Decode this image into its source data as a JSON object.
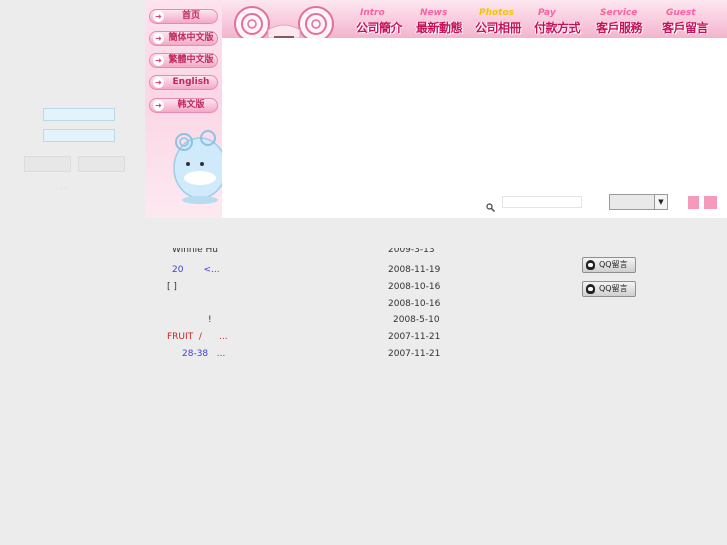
{
  "languages": [
    {
      "label": "首页"
    },
    {
      "label": "簡体中文版"
    },
    {
      "label": "繁體中文版"
    },
    {
      "label": "English"
    },
    {
      "label": "韩文版"
    }
  ],
  "nav": [
    {
      "en": "Intro",
      "zh": "公司簡介"
    },
    {
      "en": "News",
      "zh": "最新動態"
    },
    {
      "en": "Photos",
      "zh": "公司相冊"
    },
    {
      "en": "Pay",
      "zh": "付款方式"
    },
    {
      "en": "Service",
      "zh": "客戶服務"
    },
    {
      "en": "Guest",
      "zh": "客戶留言"
    }
  ],
  "left_dots": ". . .",
  "news": [
    {
      "title": "Winnie Hu",
      "date": "2009-3-13",
      "color": "#333333"
    },
    {
      "title": "20       <...",
      "date": "2008-11-19",
      "color": "#4040dd"
    },
    {
      "title": "[ ]",
      "date": "2008-10-16",
      "color": "#333333"
    },
    {
      "title": "",
      "date": "2008-10-16",
      "color": "#333333"
    },
    {
      "title": "!",
      "date": "2008-5-10",
      "color": "#333333"
    },
    {
      "title": "FRUIT  /      ...",
      "date": "2007-11-21",
      "color": "#cc2222"
    },
    {
      "title": "28-38   ...",
      "date": "2007-11-21",
      "color": "#4040dd"
    }
  ],
  "qq_buttons": [
    {
      "label": "QQ留言"
    },
    {
      "label": "QQ留言"
    }
  ],
  "colors": {
    "accent_pink": "#f59abb",
    "nav_text": "#c6115a",
    "background": "#ececec"
  },
  "icons": {
    "search": "magnifier-icon",
    "dropdown": "chevron-down-icon",
    "qq": "qq-penguin-icon"
  }
}
